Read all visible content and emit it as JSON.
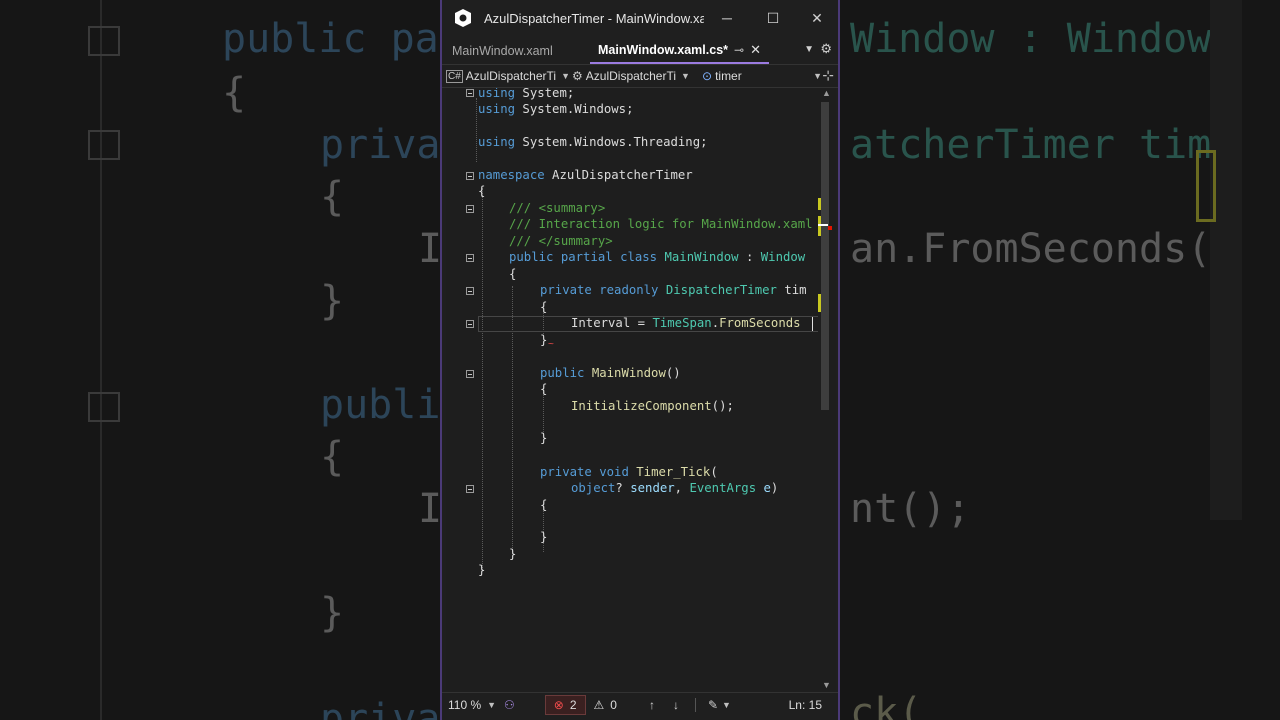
{
  "window": {
    "title": "AzulDispatcherTimer - MainWindow.xa...",
    "controls": {
      "minimize": "─",
      "maximize": "☐",
      "close": "✕"
    }
  },
  "tabs": [
    {
      "label": "MainWindow.xaml",
      "active": false
    },
    {
      "label": "MainWindow.xaml.cs*",
      "active": true,
      "pin": "⊸",
      "close": "✕"
    }
  ],
  "tab_actions": {
    "dropdown": "▼",
    "settings": "⚙"
  },
  "navbar": {
    "project": "AzulDispatcherTi",
    "class": "AzulDispatcherTi",
    "member": "timer",
    "project_icon": "C#",
    "class_icon": "⚙",
    "member_icon": "⊙"
  },
  "code": {
    "l1": [
      "using",
      " System;"
    ],
    "l2": [
      "using",
      " System.Windows;"
    ],
    "l3": [
      "using",
      " System.Windows.Threading;"
    ],
    "l4": [
      "namespace",
      " AzulDispatcherTimer"
    ],
    "l5": "{",
    "l6": "/// <summary>",
    "l7": "/// Interaction logic for MainWindow.xaml",
    "l8": "/// </summary>",
    "l9": [
      "public",
      " ",
      "partial",
      " ",
      "class",
      " ",
      "MainWindow",
      " : ",
      "Window"
    ],
    "l10": "{",
    "l11": [
      "private",
      " ",
      "readonly",
      " ",
      "DispatcherTimer",
      " tim"
    ],
    "l12": "{",
    "l13": [
      "Interval",
      " = ",
      "TimeSpan",
      ".",
      "FromSeconds"
    ],
    "l14": "}",
    "l15": [
      "public",
      " ",
      "MainWindow",
      "()"
    ],
    "l16": "{",
    "l17": [
      "InitializeComponent",
      "();"
    ],
    "l18": "}",
    "l19": [
      "private",
      " ",
      "void",
      " ",
      "Timer_Tick",
      "("
    ],
    "l20": [
      "object",
      "? ",
      "sender",
      ", ",
      "EventArgs",
      " ",
      "e",
      ")"
    ],
    "l21": "{",
    "l22": "}",
    "l23": "}",
    "l24": "}"
  },
  "status": {
    "zoom": "110 %",
    "errors": "2",
    "warnings": "0",
    "line": "Ln: 15"
  },
  "background_echo": {
    "l1": "public pa",
    "l1b": "Window : Window",
    "l2": "{",
    "l3": "privat",
    "l3b": "atcherTimer tim",
    "l4": "{",
    "l5": "I",
    "l5b": "an.FromSeconds(",
    "l6": "}",
    "l7": "publi",
    "l8": "{",
    "l9": "I",
    "l9b": "nt();",
    "l10": "}",
    "l11": "priva",
    "l11b": "ck("
  }
}
